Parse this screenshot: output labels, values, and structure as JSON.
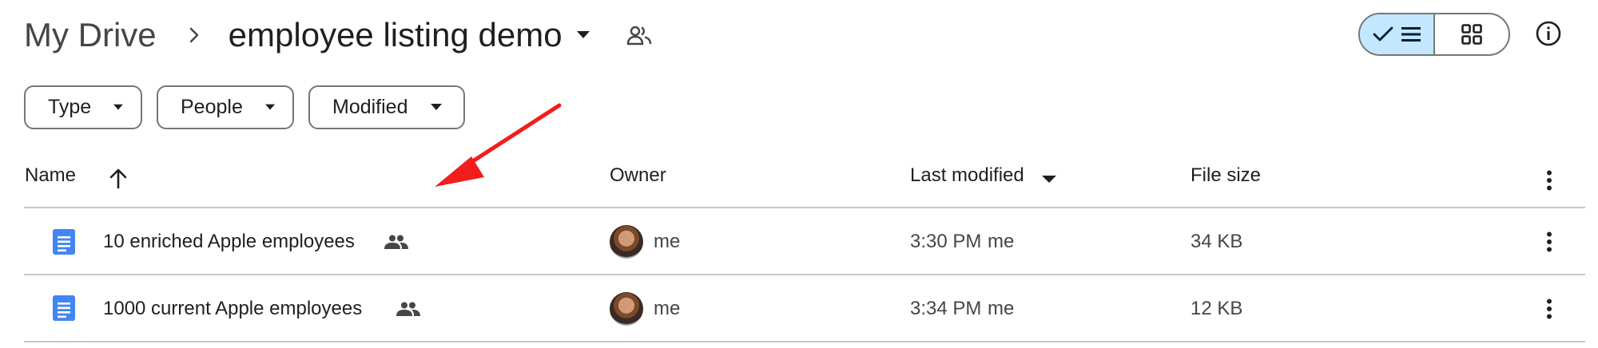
{
  "breadcrumb": {
    "root": "My Drive",
    "current": "employee listing demo"
  },
  "filters": [
    {
      "label": "Type"
    },
    {
      "label": "People"
    },
    {
      "label": "Modified"
    }
  ],
  "columns": {
    "name": "Name",
    "owner": "Owner",
    "last_modified": "Last modified",
    "file_size": "File size"
  },
  "files": [
    {
      "name": "10 enriched Apple employees",
      "owner": "me",
      "time": "3:30 PM",
      "modified_by": "me",
      "size": "34 KB",
      "icon": "google-docs-icon",
      "shared": true
    },
    {
      "name": "1000 current Apple employees",
      "owner": "me",
      "time": "3:34 PM",
      "modified_by": "me",
      "size": "12 KB",
      "icon": "google-docs-icon",
      "shared": true
    }
  ],
  "view_mode": "list",
  "annotation": {
    "type": "red-arrow",
    "color": "#f21d1d"
  },
  "colors": {
    "accent_doc": "#4285f4",
    "toggle_selected": "#c2e7ff",
    "border": "#747775",
    "divider": "#c7c7c7"
  }
}
